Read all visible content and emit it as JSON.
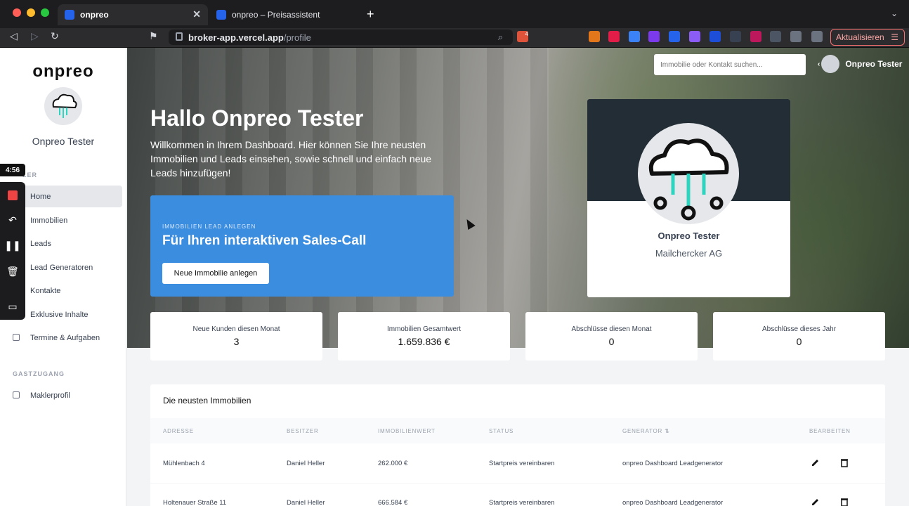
{
  "browser": {
    "tabs": [
      {
        "title": "onpreo"
      },
      {
        "title": "onpreo – Preisassistent"
      }
    ],
    "url_host": "broker-app.vercel.app",
    "url_path": "/profile",
    "update_label": "Aktualisieren",
    "shield_badge": "4"
  },
  "sidebar": {
    "logo": "onpreo",
    "user_name": "Onpreo Tester",
    "section_main": "LER",
    "items": [
      {
        "label": "Home"
      },
      {
        "label": "Immobilien"
      },
      {
        "label": "Leads"
      },
      {
        "label": "Lead Generatoren"
      },
      {
        "label": "Kontakte"
      },
      {
        "label": "Exklusive Inhalte"
      },
      {
        "label": "Termine & Aufgaben"
      }
    ],
    "section_guest": "GASTZUGANG",
    "guest_items": [
      {
        "label": "Maklerprofil"
      }
    ]
  },
  "recorder": {
    "time": "4:56"
  },
  "header": {
    "search_placeholder": "Immobilie oder Kontakt suchen...",
    "user_name": "Onpreo Tester"
  },
  "hero": {
    "greeting": "Hallo Onpreo Tester",
    "welcome": "Willkommen in Ihrem Dashboard. Hier können Sie Ihre neusten Immobilien und Leads einsehen, sowie schnell und einfach neue Leads hinzufügen!",
    "lead_kicker": "IMMOBILIEN LEAD ANLEGEN",
    "lead_title": "Für Ihren interaktiven Sales-Call",
    "lead_button": "Neue Immobilie anlegen"
  },
  "profile": {
    "name": "Onpreo Tester",
    "company": "Mailchercker AG"
  },
  "stats": [
    {
      "label": "Neue Kunden diesen Monat",
      "value": "3"
    },
    {
      "label": "Immobilien Gesamtwert",
      "value": "1.659.836 €"
    },
    {
      "label": "Abschlüsse diesen Monat",
      "value": "0"
    },
    {
      "label": "Abschlüsse dieses Jahr",
      "value": "0"
    }
  ],
  "table": {
    "title": "Die neusten Immobilien",
    "columns": [
      "ADRESSE",
      "BESITZER",
      "IMMOBILIENWERT",
      "STATUS",
      "GENERATOR ⇅",
      "BEARBEITEN"
    ],
    "rows": [
      {
        "address": "Mühlenbach 4",
        "owner": "Daniel Heller",
        "value": "262.000 €",
        "status": "Startpreis vereinbaren",
        "generator": "onpreo Dashboard Leadgenerator"
      },
      {
        "address": "Holtenauer Straße 11",
        "owner": "Daniel Heller",
        "value": "666.584 €",
        "status": "Startpreis vereinbaren",
        "generator": "onpreo Dashboard Leadgenerator"
      }
    ]
  },
  "colors": {
    "accent": "#3b8de0",
    "dark_band": "#222d35",
    "update_border": "#f87171"
  }
}
